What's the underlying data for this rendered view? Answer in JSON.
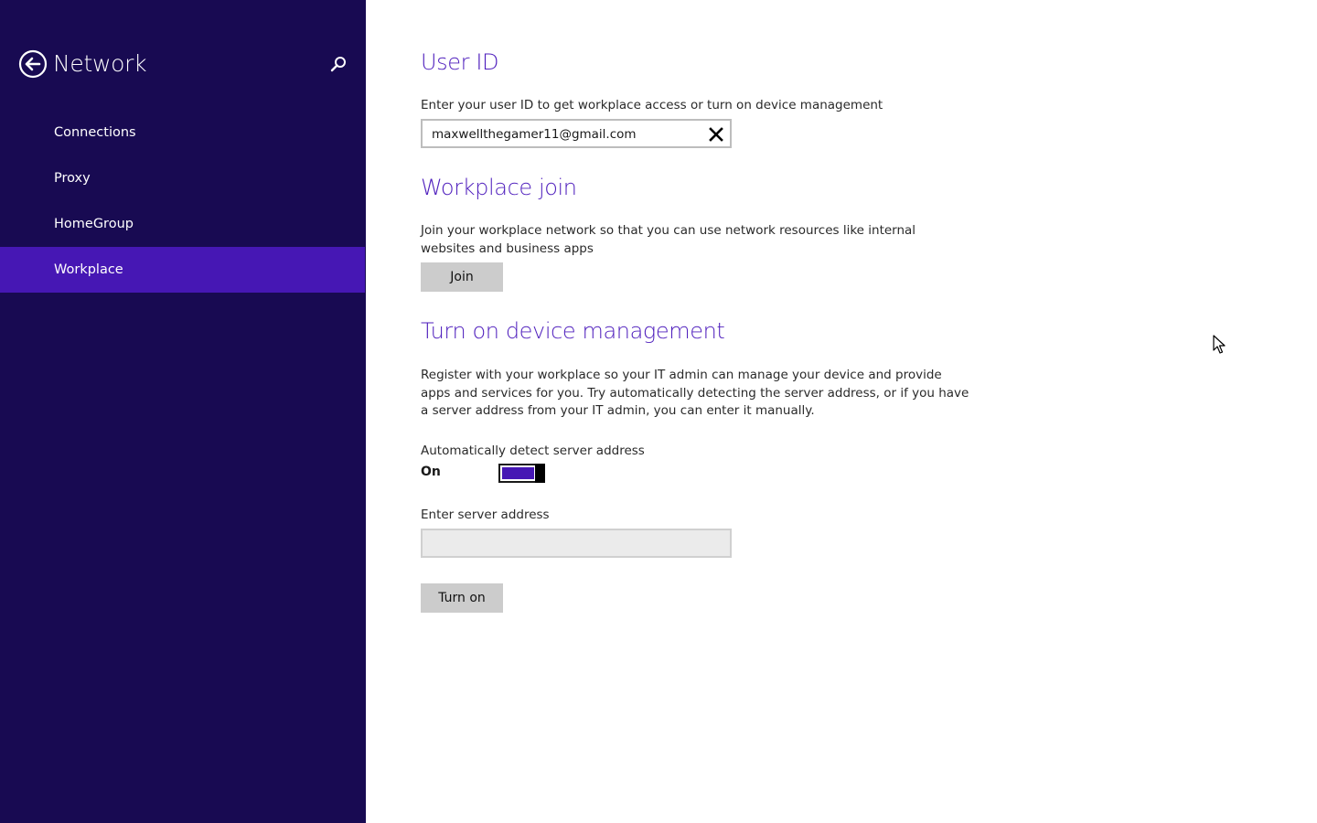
{
  "sidebar": {
    "title": "Network",
    "back_icon": "back-arrow-icon",
    "search_icon": "search-icon",
    "items": [
      {
        "label": "Connections",
        "selected": false
      },
      {
        "label": "Proxy",
        "selected": false
      },
      {
        "label": "HomeGroup",
        "selected": false
      },
      {
        "label": "Workplace",
        "selected": true
      }
    ]
  },
  "user_id": {
    "title": "User ID",
    "description": "Enter your user ID to get workplace access or turn on device management",
    "value": "maxwellthegamer11@gmail.com",
    "clear_icon": "close-icon"
  },
  "workplace_join": {
    "title": "Workplace join",
    "description": "Join your workplace network so that you can use network resources like internal websites and business apps",
    "button_label": "Join"
  },
  "device_management": {
    "title": "Turn on device management",
    "description": "Register with your workplace so your IT admin can manage your device and provide apps and services for you. Try automatically detecting the server address, or if you have a server address from your IT admin, you can enter it manually.",
    "auto_detect_label": "Automatically detect server address",
    "toggle_state": "On",
    "toggle_on": true,
    "server_address_label": "Enter server address",
    "server_address_value": "",
    "button_label": "Turn on"
  },
  "colors": {
    "sidebar_bg": "#180a52",
    "selected_bg": "#4617b4",
    "accent": "#4f1fbd"
  }
}
